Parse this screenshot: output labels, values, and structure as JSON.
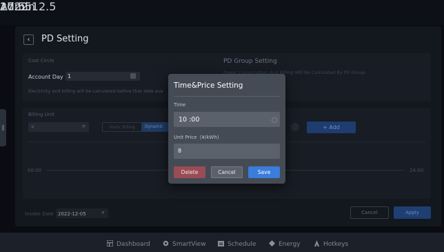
{
  "topbar": {
    "date": "2022.12.5",
    "time": "17:55",
    "user": "Admin"
  },
  "page": {
    "title": "PD Setting",
    "back_icon": "chevron-left-icon"
  },
  "cost_circle": {
    "label": "Cost Circle",
    "account_day_label": "Account Day",
    "account_day_value": "1",
    "note": "Electricity and billing will be calculated before that date eve"
  },
  "pd_group": {
    "title": "PD Group Setting",
    "description": "Power Consumption And Billing Will Be Calculated By PD Group"
  },
  "billing": {
    "label": "Billing Unit",
    "unit_value": "¥",
    "static_label": "Static Billing",
    "dynamic_label": "Dynamic",
    "add_label": "+ Add",
    "time_start": "00:00",
    "time_end": "24:00"
  },
  "invoke": {
    "label": "Invoke Date",
    "value": "2022-12-05"
  },
  "actions": {
    "cancel": "Cancel",
    "apply": "Apply"
  },
  "nav": [
    {
      "label": "Dashboard",
      "icon": "dashboard-icon"
    },
    {
      "label": "SmartView",
      "icon": "smartview-icon"
    },
    {
      "label": "Schedule",
      "icon": "schedule-icon"
    },
    {
      "label": "Energy",
      "icon": "energy-icon"
    },
    {
      "label": "Hotkeys",
      "icon": "hotkeys-icon"
    }
  ],
  "modal": {
    "title": "Time&Price Setting",
    "time_label": "Time",
    "time_value": "10 :00",
    "price_label": "Unit Price（¥/kWh)",
    "price_value": "8",
    "delete": "Delete",
    "cancel": "Cancel",
    "save": "Save"
  },
  "colors": {
    "accent": "#3a7ddb",
    "danger": "#9a4c55",
    "background": "#0a0c11"
  }
}
